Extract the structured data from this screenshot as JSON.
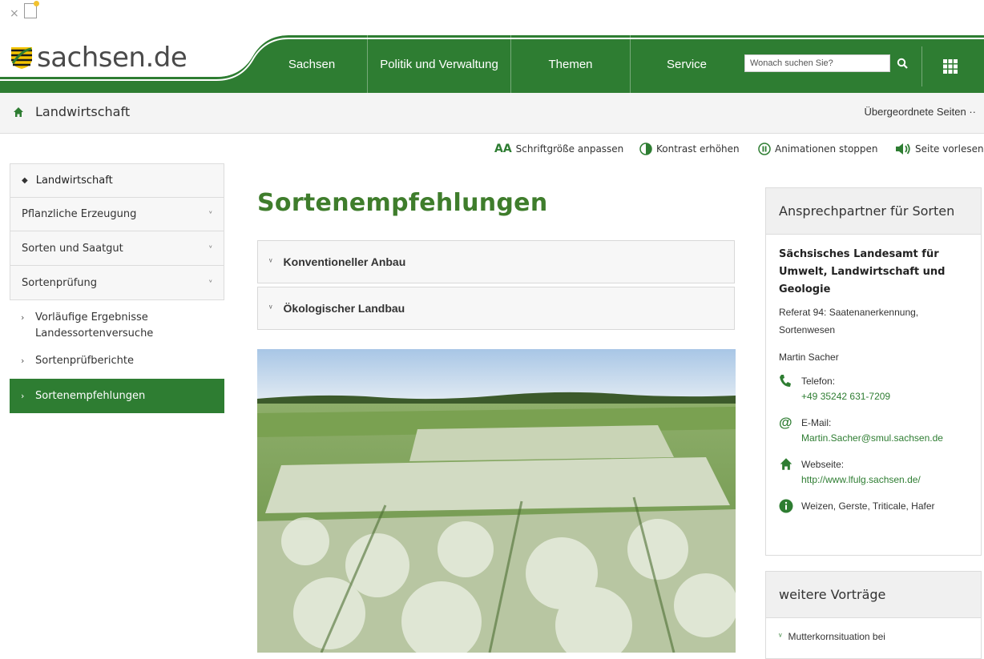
{
  "header": {
    "logo_text": "sachsen.de",
    "nav": [
      {
        "label": "Sachsen"
      },
      {
        "label": "Politik und Verwaltung"
      },
      {
        "label": "Themen"
      },
      {
        "label": "Service"
      }
    ],
    "search_placeholder": "Wonach suchen Sie?"
  },
  "breadcrumb": {
    "title": "Landwirtschaft",
    "parent_pages": "Übergeordnete Seiten"
  },
  "a11y": {
    "font_size": "Schriftgröße anpassen",
    "contrast": "Kontrast erhöhen",
    "animations": "Animationen stoppen",
    "read_aloud": "Seite vorlesen"
  },
  "sidebar": {
    "heading": "Landwirtschaft",
    "items": [
      {
        "label": "Pflanzliche Erzeugung"
      },
      {
        "label": "Sorten und Saatgut"
      },
      {
        "label": "Sortenprüfung"
      }
    ],
    "subitems": [
      {
        "label": "Vorläufige Ergebnisse Landessortenversuche"
      },
      {
        "label": "Sortenprüfberichte"
      }
    ],
    "active": "Sortenempfehlungen"
  },
  "main": {
    "title": "Sortenempfehlungen",
    "accordions": [
      {
        "label": "Konventioneller Anbau"
      },
      {
        "label": "Ökologischer Landbau"
      }
    ]
  },
  "contact_box": {
    "heading": "Ansprechpartner für Sorten",
    "organization": "Sächsisches Landesamt für Umwelt, Landwirtschaft und Geologie",
    "department": "Referat 94: Saatenanerkennung, Sortenwesen",
    "person": "Martin Sacher",
    "phone_label": "Telefon:",
    "phone": "+49 35242 631-7209",
    "email_label": "E-Mail:",
    "email": "Martin.Sacher@smul.sachsen.de",
    "web_label": "Webseite:",
    "web": "http://www.lfulg.sachsen.de/",
    "info": "Weizen, Gerste, Triticale, Hafer"
  },
  "more_box": {
    "heading": "weitere Vorträge",
    "items": [
      {
        "label": "Mutterkornsituation bei"
      }
    ]
  },
  "colors": {
    "brand_green": "#2e7d32",
    "title_green": "#3f7d2c"
  }
}
